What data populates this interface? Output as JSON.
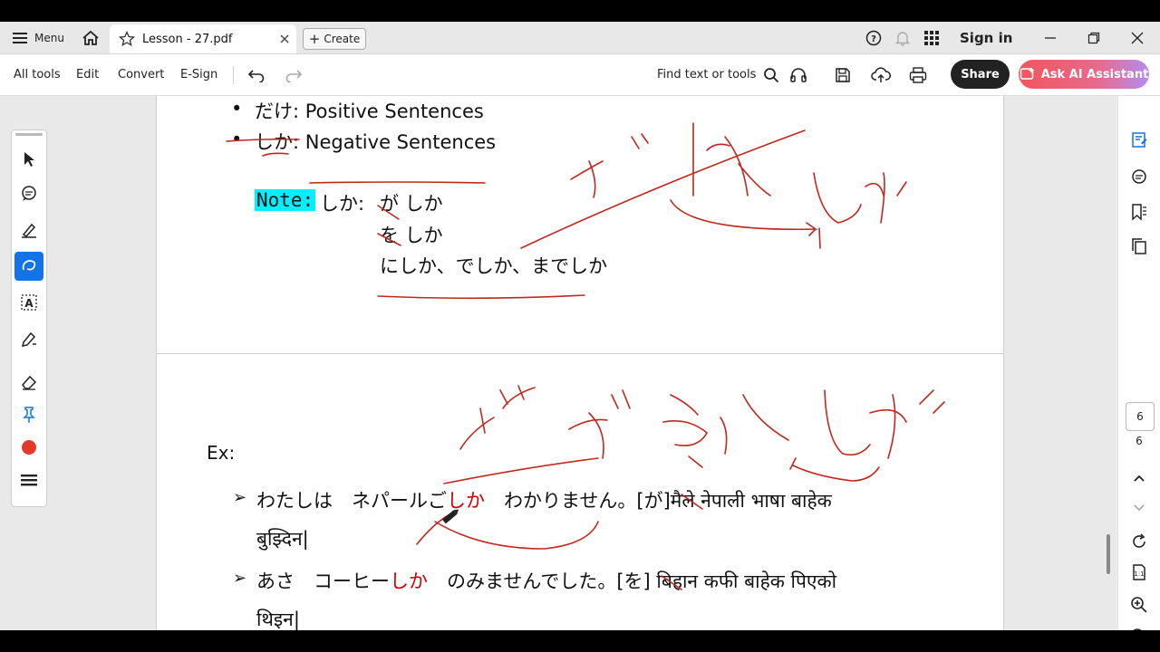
{
  "titlebar": {
    "menu_label": "Menu",
    "tab_title": "Lesson - 27.pdf",
    "create_label": "Create",
    "signin_label": "Sign in"
  },
  "toolbar": {
    "all_tools": "All tools",
    "edit": "Edit",
    "convert": "Convert",
    "esign": "E-Sign",
    "find_label": "Find text or tools",
    "share_label": "Share",
    "ai_label": "Ask AI Assistant"
  },
  "page1": {
    "bullet1_jp": "だけ",
    "bullet1_rest": ": Positive Sentences",
    "bullet2_jp": "しか",
    "bullet2_rest": ":  Negative Sentences",
    "note_label": "Note:",
    "note_shika": "しか:",
    "note_line1": "が しか",
    "note_line2": "を しか",
    "note_line3": "にしか、でしか、までしか"
  },
  "page2": {
    "ex_label": "Ex:",
    "ex1_a": "わたしは　ネパールご",
    "ex1_red": "しか",
    "ex1_b": "　わかりません。[",
    "ex1_strike": "が",
    "ex1_c": "]मैले नेपाली भाषा बाहेक",
    "ex1_line2": "बुझ्दिन|",
    "ex2_a": "あさ　コーヒー",
    "ex2_red": "しか",
    "ex2_b": "　のみませんでした。[",
    "ex2_strike": "を",
    "ex2_c": "] बिहान कफी बाहेक पिएको",
    "ex2_line2": "थिइन|"
  },
  "rightrail": {
    "current_page": "6",
    "total_pages": "6"
  },
  "colors": {
    "accent": "#1473e6",
    "ink": "#c0281e",
    "note_highlight": "#00f0ff"
  }
}
